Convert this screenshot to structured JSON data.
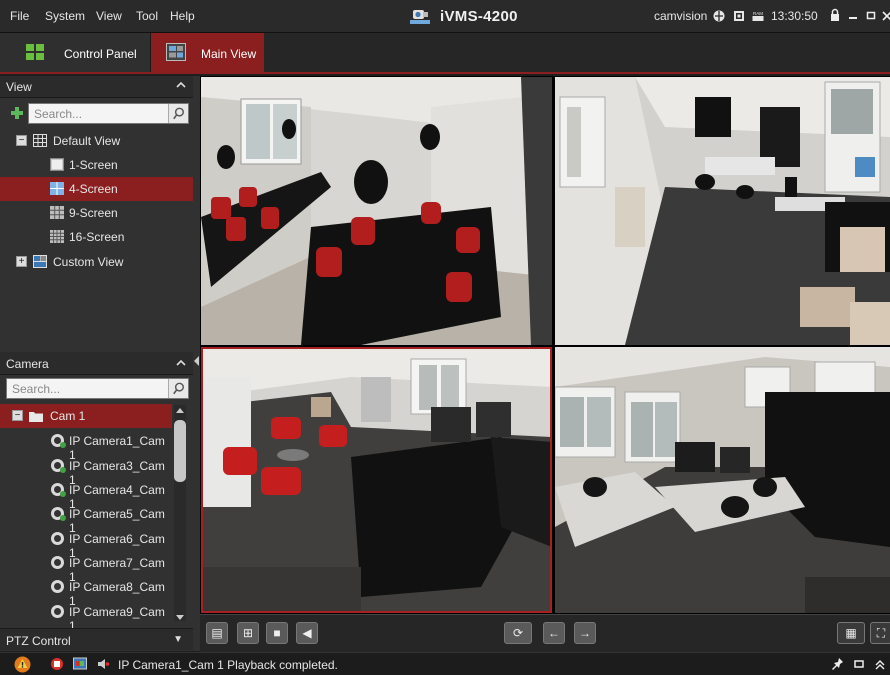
{
  "menubar": {
    "items": [
      "File",
      "System",
      "View",
      "Tool",
      "Help"
    ],
    "app_title": "iVMS-4200",
    "user": "camvision",
    "clock": "13:30:50"
  },
  "tabs": [
    {
      "label": "Control Panel",
      "active": false
    },
    {
      "label": "Main View",
      "active": true
    }
  ],
  "view_panel": {
    "title": "View",
    "search_placeholder": "Search...",
    "tree": [
      {
        "label": "Default View",
        "expanded": true,
        "level": 0
      },
      {
        "label": "1-Screen",
        "level": 1,
        "selected": false
      },
      {
        "label": "4-Screen",
        "level": 1,
        "selected": true
      },
      {
        "label": "9-Screen",
        "level": 1,
        "selected": false
      },
      {
        "label": "16-Screen",
        "level": 1,
        "selected": false
      },
      {
        "label": "Custom View",
        "expanded": false,
        "level": 0
      }
    ]
  },
  "camera_panel": {
    "title": "Camera",
    "search_placeholder": "Search...",
    "group": "Cam 1",
    "cameras": [
      "IP Camera1_Cam 1",
      "IP Camera3_Cam 1",
      "IP Camera4_Cam 1",
      "IP Camera5_Cam 1",
      "IP Camera6_Cam 1",
      "IP Camera7_Cam 1",
      "IP Camera8_Cam 1",
      "IP Camera9_Cam 1"
    ]
  },
  "ptz": {
    "title": "PTZ Control"
  },
  "status": {
    "message": "IP Camera1_Cam 1 Playback completed."
  },
  "colors": {
    "accent": "#8b1f1f",
    "selection": "#a82020",
    "background": "#1e1e1e"
  },
  "icons": {
    "toolbar": [
      "layout-icon",
      "multi-layout-icon",
      "stop-all-icon",
      "mute-icon",
      "refresh-icon",
      "prev-icon",
      "next-icon",
      "window-mode-icon",
      "fullscreen-icon"
    ],
    "status": [
      "alarm-icon",
      "record-icon",
      "screen-icon",
      "audio-icon",
      "pin-icon",
      "restore-icon",
      "collapse-icon"
    ]
  }
}
